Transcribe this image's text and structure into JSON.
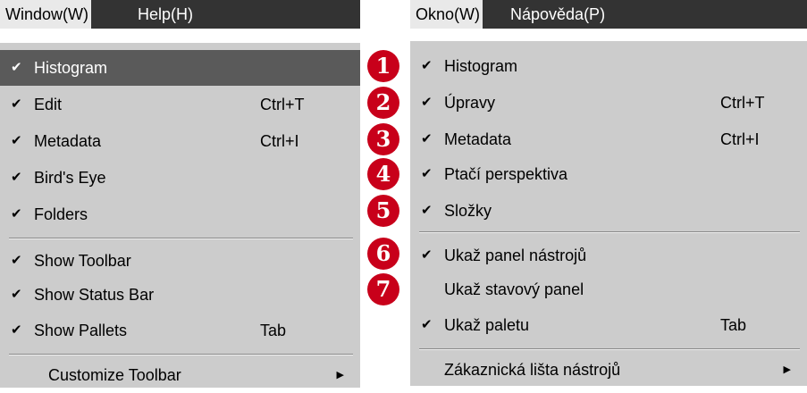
{
  "left": {
    "menubar": {
      "active": "Window(W)",
      "other": "Help(H)"
    },
    "items": [
      {
        "label": "Histogram",
        "checked": true,
        "shortcut": ""
      },
      {
        "label": "Edit",
        "checked": true,
        "shortcut": "Ctrl+T"
      },
      {
        "label": "Metadata",
        "checked": true,
        "shortcut": "Ctrl+I"
      },
      {
        "label": "Bird's Eye",
        "checked": true,
        "shortcut": ""
      },
      {
        "label": "Folders",
        "checked": true,
        "shortcut": ""
      },
      {
        "label": "Show Toolbar",
        "checked": true,
        "shortcut": ""
      },
      {
        "label": "Show Status Bar",
        "checked": true,
        "shortcut": ""
      },
      {
        "label": "Show Pallets",
        "checked": true,
        "shortcut": "Tab"
      },
      {
        "label": "Customize Toolbar",
        "checked": false,
        "shortcut": ""
      }
    ]
  },
  "right": {
    "menubar": {
      "active": "Okno(W)",
      "other": "Nápověda(P)"
    },
    "items": [
      {
        "label": "Histogram",
        "checked": true,
        "shortcut": "",
        "badge": "1"
      },
      {
        "label": "Úpravy",
        "checked": true,
        "shortcut": "Ctrl+T",
        "badge": "2"
      },
      {
        "label": "Metadata",
        "checked": true,
        "shortcut": "Ctrl+I",
        "badge": "3"
      },
      {
        "label": "Ptačí perspektiva",
        "checked": true,
        "shortcut": "",
        "badge": "4"
      },
      {
        "label": "Složky",
        "checked": true,
        "shortcut": "",
        "badge": "5"
      },
      {
        "label": "Ukaž panel nástrojů",
        "checked": true,
        "shortcut": "",
        "badge": "6"
      },
      {
        "label": "Ukaž stavový panel",
        "checked": false,
        "shortcut": "",
        "badge": "7"
      },
      {
        "label": "Ukaž paletu",
        "checked": true,
        "shortcut": "Tab"
      },
      {
        "label": "Zákaznická lišta nástrojů",
        "checked": false,
        "shortcut": ""
      }
    ]
  },
  "glyphs": {
    "check": "✔",
    "submenu": "▶"
  },
  "colors": {
    "menubar": "#333333",
    "menu": "#cccccc",
    "highlight": "#5a5a5a",
    "badge": "#c8001a"
  }
}
